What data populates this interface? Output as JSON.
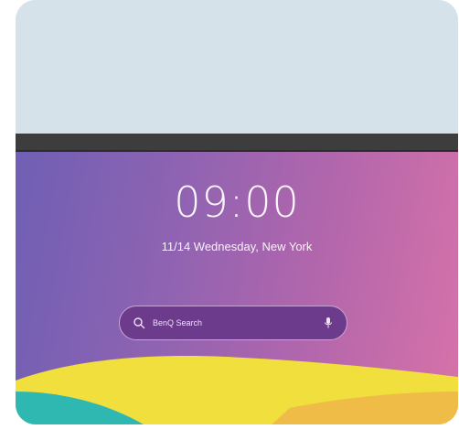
{
  "lockscreen": {
    "time": "09:00",
    "date_location": "11/14 Wednesday, New York"
  },
  "search": {
    "placeholder": "BenQ Search",
    "search_icon": "search-icon",
    "mic_icon": "microphone-icon"
  },
  "colors": {
    "top_background": "#d5e2ea",
    "bezel": "#3d3d3d",
    "gradient_left": "#6f5fb4",
    "gradient_right": "#d772a9",
    "wave_yellow": "#f1df3e",
    "wave_teal": "#2fb8b2"
  }
}
